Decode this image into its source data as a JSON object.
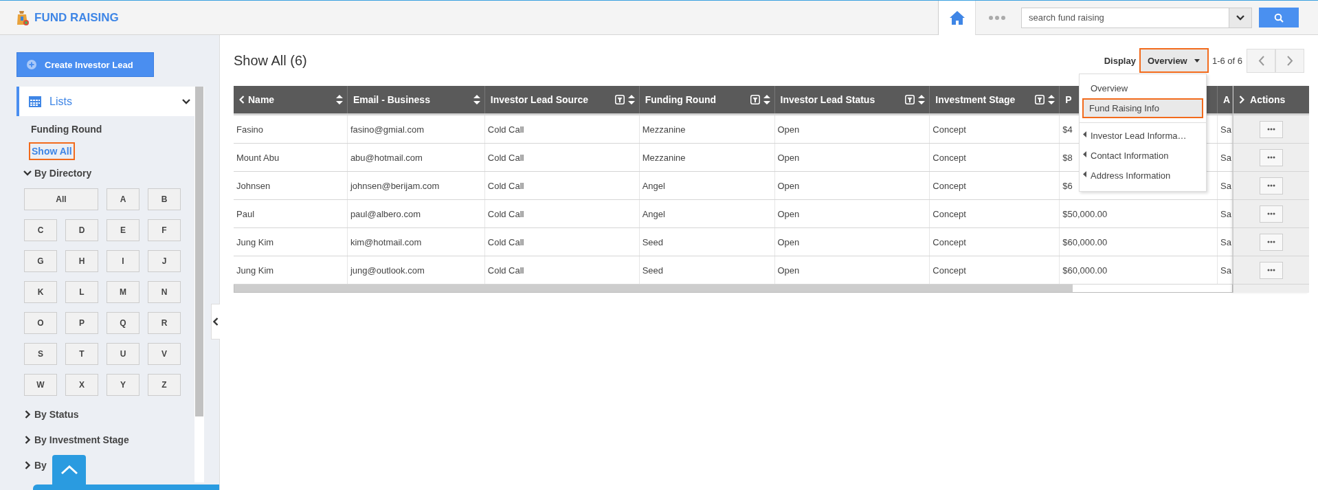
{
  "app": {
    "title": "FUND RAISING"
  },
  "search": {
    "placeholder": "search fund raising"
  },
  "sidebar": {
    "create_button": "Create Investor Lead",
    "section": {
      "label": "Lists",
      "expanded": true
    },
    "items": [
      {
        "label": "Funding Round",
        "selected": false
      },
      {
        "label": "Show All",
        "selected": true
      }
    ],
    "directory": {
      "label": "By Directory",
      "expanded": true,
      "letters": [
        "All",
        "A",
        "B",
        "C",
        "D",
        "E",
        "F",
        "G",
        "H",
        "I",
        "J",
        "K",
        "L",
        "M",
        "N",
        "O",
        "P",
        "Q",
        "R",
        "S",
        "T",
        "U",
        "V",
        "W",
        "X",
        "Y",
        "Z"
      ]
    },
    "groups": [
      {
        "label": "By Status",
        "expanded": false
      },
      {
        "label": "By Investment Stage",
        "expanded": false
      },
      {
        "label": "By",
        "expanded": false
      }
    ]
  },
  "main": {
    "title": "Show All (6)",
    "display_label": "Display",
    "display_value": "Overview",
    "page_info": "1-6 of 6"
  },
  "display_menu": [
    {
      "label": "Overview",
      "kind": "item",
      "selected": false
    },
    {
      "label": "Fund Raising Info",
      "kind": "item",
      "selected": true
    },
    {
      "label": "Investor Lead Informa…",
      "kind": "submenu",
      "selected": false
    },
    {
      "label": "Contact Information",
      "kind": "submenu",
      "selected": false
    },
    {
      "label": "Address Information",
      "kind": "submenu",
      "selected": false
    }
  ],
  "table": {
    "columns": [
      {
        "label": "Name",
        "filter": false,
        "sort": true
      },
      {
        "label": "Email - Business",
        "filter": false,
        "sort": true
      },
      {
        "label": "Investor Lead Source",
        "filter": true,
        "sort": true
      },
      {
        "label": "Funding Round",
        "filter": true,
        "sort": true
      },
      {
        "label": "Investor Lead Status",
        "filter": true,
        "sort": true
      },
      {
        "label": "Investment Stage",
        "filter": true,
        "sort": true
      },
      {
        "label": "P",
        "filter": false,
        "sort": false
      },
      {
        "label": "A",
        "filter": false,
        "sort": false
      }
    ],
    "actions_label": "Actions",
    "rows": [
      [
        "Fasino",
        "fasino@gmial.com",
        "Cold Call",
        "Mezzanine",
        "Open",
        "Concept",
        "$4",
        "Sa"
      ],
      [
        "Mount Abu",
        "abu@hotmail.com",
        "Cold Call",
        "Mezzanine",
        "Open",
        "Concept",
        "$8",
        "Sa"
      ],
      [
        "Johnsen",
        "johnsen@berijam.com",
        "Cold Call",
        "Angel",
        "Open",
        "Concept",
        "$6",
        "Sa"
      ],
      [
        "Paul",
        "paul@albero.com",
        "Cold Call",
        "Angel",
        "Open",
        "Concept",
        "$50,000.00",
        "Sa"
      ],
      [
        "Jung Kim",
        "kim@hotmail.com",
        "Cold Call",
        "Seed",
        "Open",
        "Concept",
        "$60,000.00",
        "Sa"
      ],
      [
        "Jung Kim",
        "jung@outlook.com",
        "Cold Call",
        "Seed",
        "Open",
        "Concept",
        "$60,000.00",
        "Sa"
      ]
    ]
  }
}
